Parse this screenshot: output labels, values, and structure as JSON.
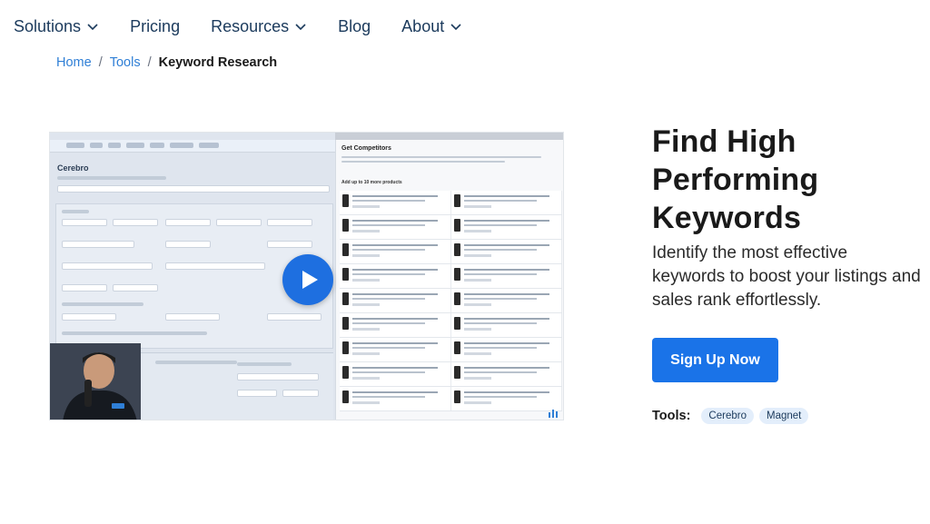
{
  "nav": {
    "items": [
      {
        "label": "Solutions",
        "dropdown": true
      },
      {
        "label": "Pricing",
        "dropdown": false
      },
      {
        "label": "Resources",
        "dropdown": true
      },
      {
        "label": "Blog",
        "dropdown": false
      },
      {
        "label": "About",
        "dropdown": true
      }
    ]
  },
  "breadcrumb": {
    "items": [
      "Home",
      "Tools"
    ],
    "separator": "/",
    "current": "Keyword Research"
  },
  "video": {
    "screen_title": "Cerebro",
    "panel_title": "Get Competitors",
    "panel_add_text": "Add up to 10 more products",
    "play_icon": "play-icon"
  },
  "hero": {
    "title": "Find High Performing Keywords",
    "subtitle": "Identify the most effective keywords to boost your listings and sales rank effortlessly.",
    "cta_label": "Sign Up Now"
  },
  "tools": {
    "label": "Tools:",
    "tags": [
      "Cerebro",
      "Magnet"
    ]
  },
  "colors": {
    "accent": "#1a73e8",
    "nav_text": "#1b3a5c",
    "link": "#2f7fd6",
    "tag_bg": "#e3eefb"
  }
}
